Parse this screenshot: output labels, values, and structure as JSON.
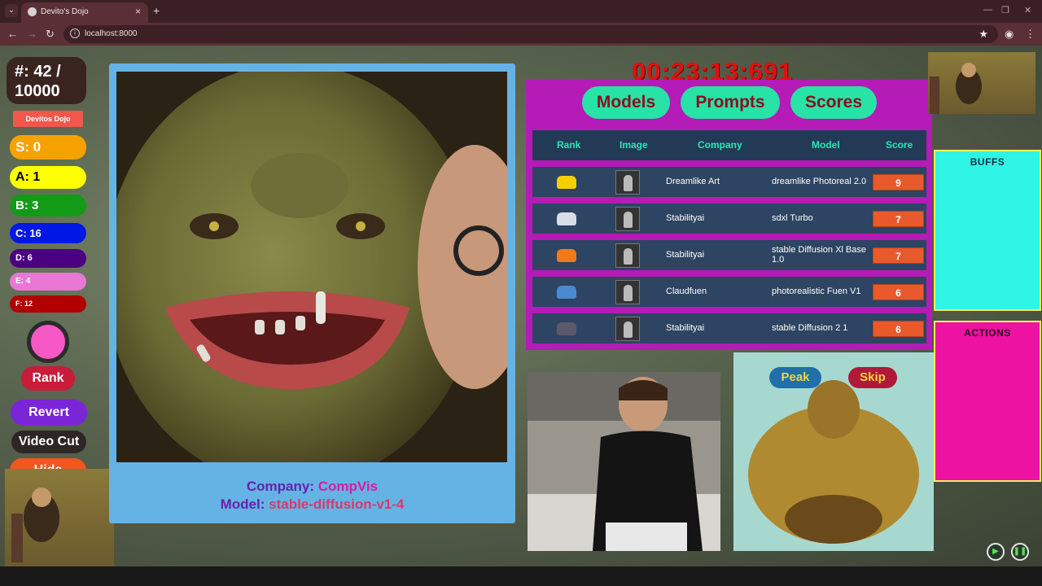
{
  "browser": {
    "tab_title": "Devito's Dojo",
    "tab_close": "×",
    "new_tab": "+",
    "url": "localhost:8000",
    "win_min": "—",
    "win_max": "❐",
    "win_close": "✕"
  },
  "left_panel": {
    "counter_line1": "#: 42 /",
    "counter_line2": "10000",
    "dojo_button": "Devitos Dojo",
    "tiers": {
      "s": "S: 0",
      "a": "A: 1",
      "b": "B: 3",
      "c": "C: 16",
      "d": "D: 6",
      "e": "E: 4",
      "f": "F: 12"
    },
    "rank_button": "Rank",
    "revert_button": "Revert",
    "video_cut_button": "Video Cut",
    "hide_button": "Hide"
  },
  "main": {
    "company_label": "Company:",
    "company_value": "CompVis",
    "model_label": "Model:",
    "model_value": "stable-diffusion-v1-4"
  },
  "timer": "00:23:13:691",
  "leaderboard": {
    "tabs": [
      "Models",
      "Prompts",
      "Scores"
    ],
    "headers": [
      "Rank",
      "Image",
      "Company",
      "Model",
      "Score"
    ],
    "rows": [
      {
        "rank_icon": "gold-trophy-icon",
        "company": "Dreamlike Art",
        "model": "dreamlike Photoreal 2.0",
        "score": "9"
      },
      {
        "rank_icon": "silver-trophy-icon",
        "company": "Stabilityai",
        "model": "sdxl Turbo",
        "score": "7"
      },
      {
        "rank_icon": "orange-trophy-icon",
        "company": "Stabilityai",
        "model": "stable Diffusion Xl Base 1.0",
        "score": "7"
      },
      {
        "rank_icon": "blue-trophy-icon",
        "company": "Claudfuen",
        "model": "photorealistic Fuen V1",
        "score": "6"
      },
      {
        "rank_icon": "dark-trophy-icon",
        "company": "Stabilityai",
        "model": "stable Diffusion 2 1",
        "score": "6"
      }
    ]
  },
  "peek_panel": {
    "peak_button": "Peak",
    "skip_button": "Skip"
  },
  "side": {
    "buffs_title": "BUFFS",
    "actions_title": "ACTIONS"
  },
  "colors": {
    "leaderboard_bg": "#b41bb7",
    "tab_button": "#28e2a6",
    "timer": "#e01010",
    "buffs_bg": "#2ff5e6",
    "actions_bg": "#ee12a2",
    "main_panel": "#65b3e5"
  }
}
